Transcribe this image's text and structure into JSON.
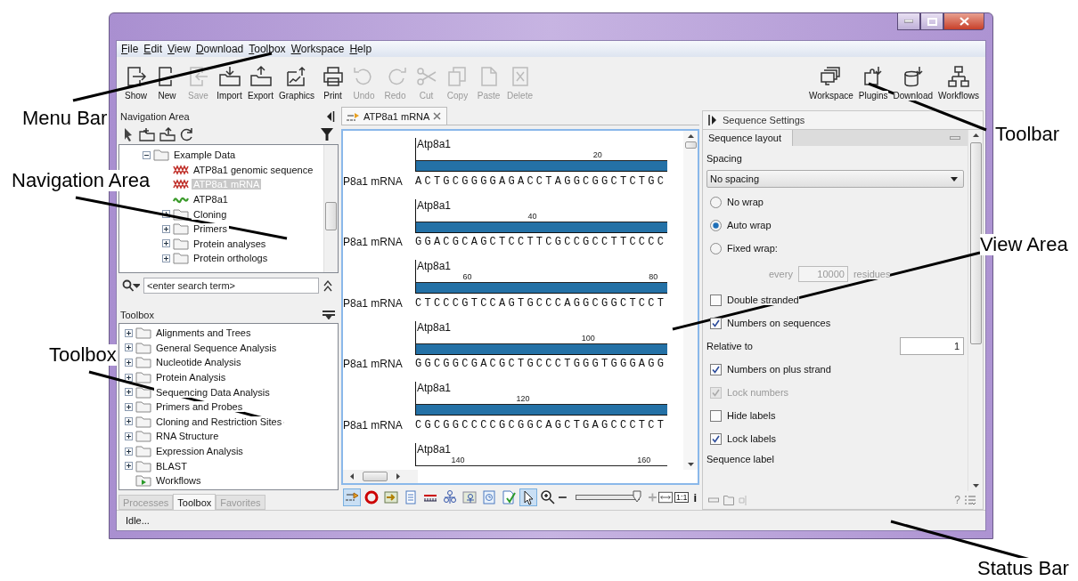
{
  "menu_bar": [
    "File",
    "Edit",
    "View",
    "Download",
    "Toolbox",
    "Workspace",
    "Help"
  ],
  "toolbar": {
    "left": [
      {
        "label": "Show",
        "kind": "show",
        "disabled": false
      },
      {
        "label": "New",
        "kind": "new",
        "disabled": false
      },
      {
        "label": "Save",
        "kind": "save",
        "disabled": true
      },
      {
        "label": "Import",
        "kind": "import",
        "disabled": false
      },
      {
        "label": "Export",
        "kind": "export",
        "disabled": false
      },
      {
        "label": "Graphics",
        "kind": "graphics",
        "disabled": false
      },
      {
        "label": "Print",
        "kind": "print",
        "disabled": false
      },
      {
        "label": "Undo",
        "kind": "undo",
        "disabled": true
      },
      {
        "label": "Redo",
        "kind": "redo",
        "disabled": true
      },
      {
        "label": "Cut",
        "kind": "cut",
        "disabled": true
      },
      {
        "label": "Copy",
        "kind": "copy",
        "disabled": true
      },
      {
        "label": "Paste",
        "kind": "paste",
        "disabled": true
      },
      {
        "label": "Delete",
        "kind": "delete",
        "disabled": true
      }
    ],
    "right": [
      {
        "label": "Workspace",
        "kind": "workspace",
        "disabled": false
      },
      {
        "label": "Plugins",
        "kind": "plugins",
        "disabled": false
      },
      {
        "label": "Download",
        "kind": "download",
        "disabled": false
      },
      {
        "label": "Workflows",
        "kind": "workflows",
        "disabled": false
      }
    ]
  },
  "navigation_area": {
    "title": "Navigation Area",
    "tree": [
      {
        "label": "Example Data",
        "kind": "folder",
        "expanded": true,
        "selected": false,
        "children": [
          {
            "label": "ATP8a1 genomic sequence",
            "kind": "nucleotide",
            "selected": false
          },
          {
            "label": "ATP8a1 mRNA",
            "kind": "nucleotide",
            "selected": true
          },
          {
            "label": "ATP8a1",
            "kind": "protein",
            "selected": false
          },
          {
            "label": "Cloning",
            "kind": "folder",
            "expanded": false,
            "selected": false
          },
          {
            "label": "Primers",
            "kind": "folder",
            "expanded": false,
            "selected": false
          },
          {
            "label": "Protein analyses",
            "kind": "folder",
            "expanded": false,
            "selected": false
          },
          {
            "label": "Protein orthologs",
            "kind": "folder",
            "expanded": false,
            "selected": false
          }
        ]
      }
    ],
    "search": {
      "placeholder": "<enter search term>"
    }
  },
  "toolbox": {
    "title": "Toolbox",
    "items": [
      {
        "label": "Alignments and Trees",
        "kind": "category",
        "expanded": false
      },
      {
        "label": "General Sequence Analysis",
        "kind": "category",
        "expanded": false
      },
      {
        "label": "Nucleotide Analysis",
        "kind": "category",
        "expanded": false
      },
      {
        "label": "Protein Analysis",
        "kind": "category",
        "expanded": false
      },
      {
        "label": "Sequencing Data Analysis",
        "kind": "category",
        "expanded": false
      },
      {
        "label": "Primers and Probes",
        "kind": "category",
        "expanded": false
      },
      {
        "label": "Cloning and Restriction Sites",
        "kind": "category",
        "expanded": false
      },
      {
        "label": "RNA Structure",
        "kind": "category",
        "expanded": false
      },
      {
        "label": "Expression Analysis",
        "kind": "category",
        "expanded": false
      },
      {
        "label": "BLAST",
        "kind": "category",
        "expanded": false
      },
      {
        "label": "Workflows",
        "kind": "workflows"
      }
    ]
  },
  "panel_tabs": [
    {
      "label": "Processes",
      "selected": false
    },
    {
      "label": "Toolbox",
      "selected": true
    },
    {
      "label": "Favorites",
      "selected": false
    }
  ],
  "editor": {
    "tab": {
      "label": "ATP8a1 mRNA"
    },
    "rows": [
      {
        "annotation": "Atp8a1",
        "ticks": [
          "20"
        ],
        "name": "P8a1 mRNA",
        "sequence": "ACTGCGGGGAGACCTAGGCGGCTCTGC"
      },
      {
        "annotation": "Atp8a1",
        "ticks": [
          "40"
        ],
        "name": "P8a1 mRNA",
        "sequence": "GGACGCAGCTCCTTCGCCGCCTTCCCC"
      },
      {
        "annotation": "Atp8a1",
        "ticks": [
          "60",
          "80"
        ],
        "name": "P8a1 mRNA",
        "sequence": "CTCCCGTCCAGTGCCCAGGCGGCTCCT"
      },
      {
        "annotation": "Atp8a1",
        "ticks": [
          "100"
        ],
        "name": "P8a1 mRNA",
        "sequence": "GGCGGCGACGCTGCCCTGGGTGGGAGG"
      },
      {
        "annotation": "Atp8a1",
        "ticks": [
          "120"
        ],
        "name": "P8a1 mRNA",
        "sequence": "CGCGGCCCCGCGGCAGCTGAGCCCTCT"
      },
      {
        "annotation": "Atp8a1",
        "ticks": [
          "140",
          "160"
        ]
      }
    ],
    "tools": [
      {
        "kind": "sequence",
        "selected": true
      },
      {
        "kind": "circular",
        "selected": false
      },
      {
        "kind": "table",
        "selected": false
      },
      {
        "kind": "text",
        "selected": false
      },
      {
        "kind": "annotations",
        "selected": false
      },
      {
        "kind": "structure",
        "selected": false
      },
      {
        "kind": "structuretable",
        "selected": false
      },
      {
        "kind": "history",
        "selected": false
      },
      {
        "kind": "report",
        "selected": false
      },
      {
        "kind": "select",
        "selected": true
      },
      {
        "kind": "zoom",
        "selected": false
      }
    ],
    "zoom_slider": {
      "level": 0.97
    },
    "one_to_one": "1:1",
    "info": "i"
  },
  "settings": {
    "title": "Sequence Settings",
    "tab": "Sequence layout",
    "items": [
      {
        "kind": "heading",
        "text": "Spacing"
      },
      {
        "kind": "select",
        "value": "No spacing"
      },
      {
        "kind": "radio",
        "label": "No wrap",
        "selected": false
      },
      {
        "kind": "radio",
        "label": "Auto wrap",
        "selected": true
      },
      {
        "kind": "radio",
        "label": "Fixed wrap:",
        "selected": false
      },
      {
        "kind": "wrapfield",
        "prefix": "every",
        "value": "10000",
        "suffix": "residues",
        "disabled": true
      },
      {
        "kind": "checkbox",
        "label": "Double stranded",
        "checked": false,
        "disabled": false
      },
      {
        "kind": "checkbox",
        "label": "Numbers on sequences",
        "checked": true,
        "disabled": false
      },
      {
        "kind": "field",
        "label": "Relative to",
        "value": "1"
      },
      {
        "kind": "checkbox",
        "label": "Numbers on plus strand",
        "checked": true,
        "disabled": false
      },
      {
        "kind": "checkbox",
        "label": "Lock numbers",
        "checked": true,
        "disabled": true
      },
      {
        "kind": "checkbox",
        "label": "Hide labels",
        "checked": false,
        "disabled": false
      },
      {
        "kind": "checkbox",
        "label": "Lock labels",
        "checked": true,
        "disabled": false
      },
      {
        "kind": "heading",
        "text": "Sequence label"
      }
    ],
    "help": "?"
  },
  "status_bar": {
    "text": "Idle..."
  },
  "callouts": [
    {
      "label": "Menu Bar"
    },
    {
      "label": "Navigation Area"
    },
    {
      "label": "Toolbox"
    },
    {
      "label": "Toolbar"
    },
    {
      "label": "View Area"
    },
    {
      "label": "Status Bar"
    }
  ]
}
